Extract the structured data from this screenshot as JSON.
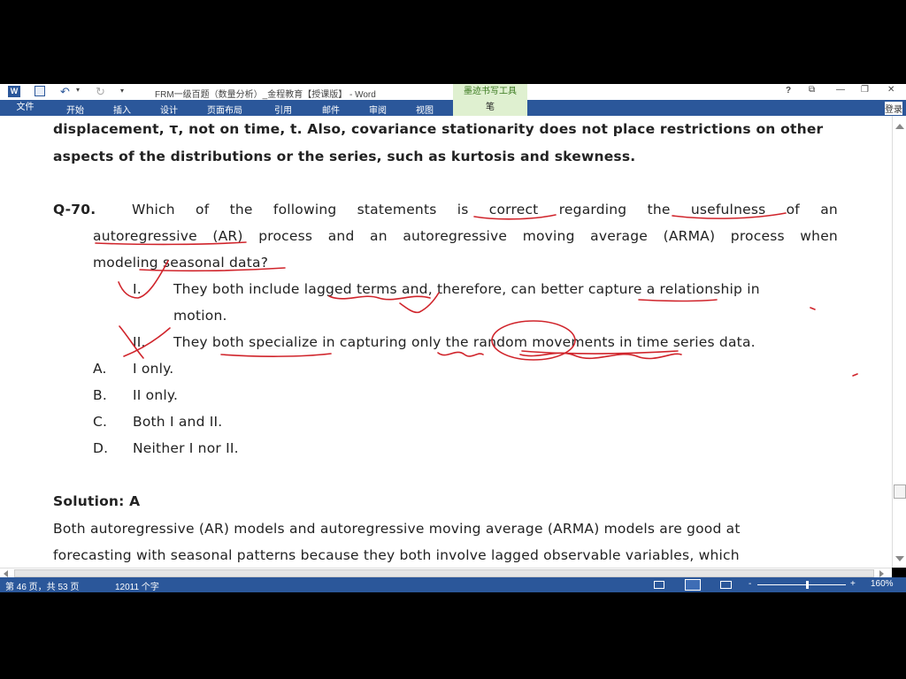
{
  "titlebar": {
    "title": "FRM一级百题（数量分析）_金程教育【授课版】 - Word",
    "ink_tools_label": "墨迹书写工具",
    "help": "?",
    "restore_ribbon": "⧉",
    "minimize": "—",
    "maximize": "❐",
    "close": "✕",
    "undo_glyph": "↶",
    "redo_glyph": "↻",
    "qat_more": "▾"
  },
  "ribbon": {
    "tabs": [
      "文件",
      "开始",
      "插入",
      "设计",
      "页面布局",
      "引用",
      "邮件",
      "审阅",
      "视图"
    ],
    "ink_tab": "笔",
    "login": "登录"
  },
  "doc": {
    "intro_line1": "displacement, τ, not on time, t. Also, covariance stationarity does not place restrictions on other",
    "intro_line2": "aspects of the distributions or the series, such as kurtosis and skewness.",
    "q_number": "Q-70.",
    "q_line1_words": [
      "Which",
      "of",
      "the",
      "following",
      "statements",
      "is",
      "correct",
      "regarding",
      "the",
      "usefulness",
      "of",
      "an"
    ],
    "q_line2_words": [
      "autoregressive",
      "(AR)",
      "process",
      "and",
      "an",
      "autoregressive",
      "moving",
      "average",
      "(ARMA)",
      "process",
      "when"
    ],
    "q_line3": "modeling seasonal data?",
    "item1_num": "I.",
    "item1_line1": "They both include lagged terms and, therefore, can better capture a relationship in",
    "item1_line2": "motion.",
    "item2_num": "II.",
    "item2_line1": "They both specialize in capturing only the random movements in time series data.",
    "options": [
      {
        "letter": "A.",
        "text": "I only."
      },
      {
        "letter": "B.",
        "text": "II only."
      },
      {
        "letter": "C.",
        "text": "Both I and II."
      },
      {
        "letter": "D.",
        "text": "Neither I nor II."
      }
    ],
    "solution": "Solution: A",
    "sol_line1": "Both autoregressive (AR) models and autoregressive moving average (ARMA) models are good at",
    "sol_line2": "forecasting with seasonal patterns because they both involve lagged observable variables, which"
  },
  "status": {
    "page": "第 46 页，共 53 页",
    "words": "12011 个字",
    "zoom": "160%",
    "zoom_minus": "-",
    "zoom_plus": "+"
  },
  "colors": {
    "ribbon_blue": "#2b579a",
    "ink_red": "#d0242b",
    "ink_tools_green": "#dff0d0"
  }
}
